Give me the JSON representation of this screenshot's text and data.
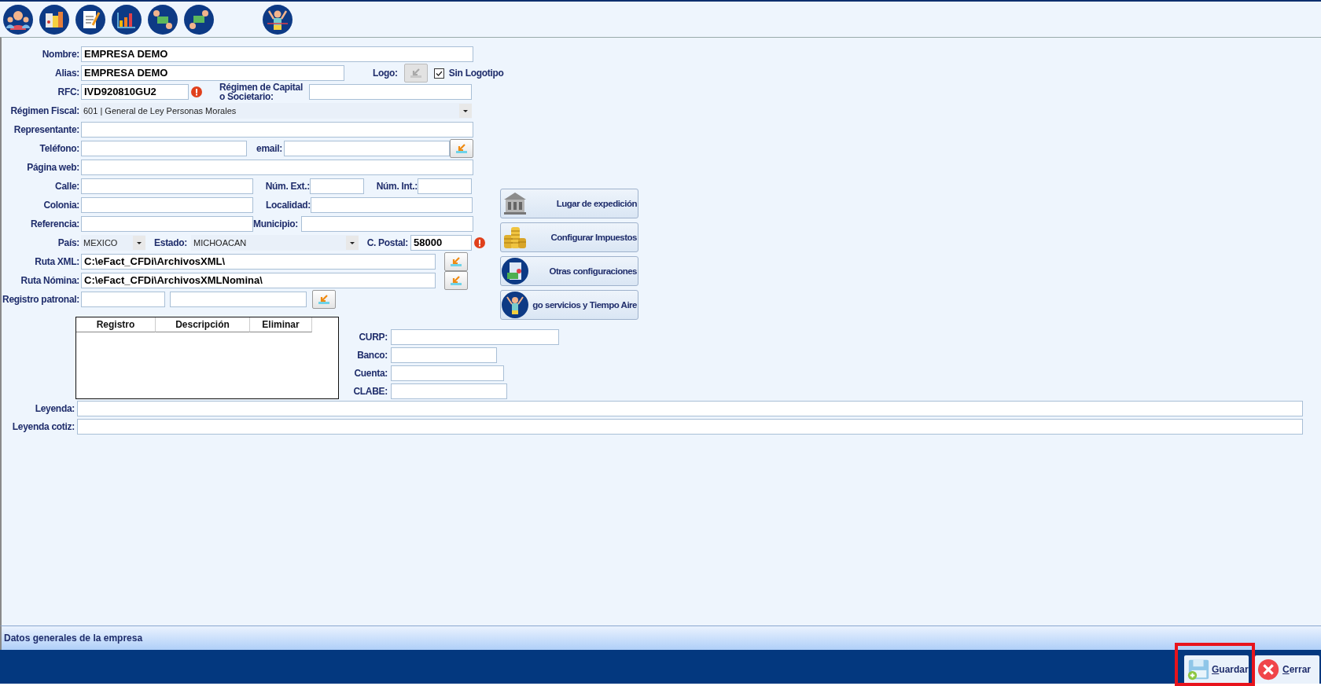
{
  "form": {
    "nombre": {
      "label": "Nombre:",
      "value": "EMPRESA DEMO"
    },
    "alias": {
      "label": "Alias:",
      "value": "EMPRESA DEMO"
    },
    "logo": {
      "label": "Logo:",
      "disabled": true
    },
    "sin_logotipo": {
      "label": "Sin Logotipo",
      "checked": true
    },
    "rfc": {
      "label": "RFC:",
      "value": "IVD920810GU2",
      "error": true
    },
    "regimen_capital": {
      "label": "Régimen de Capital o Societario:"
    },
    "regimen_fiscal": {
      "label": "Régimen Fiscal:",
      "value": "601 | General de Ley Personas Morales"
    },
    "representante": {
      "label": "Representante:"
    },
    "telefono": {
      "label": "Teléfono:"
    },
    "email": {
      "label": "email:"
    },
    "pagina_web": {
      "label": "Página web:"
    },
    "calle": {
      "label": "Calle:"
    },
    "num_ext": {
      "label": "Núm. Ext.:"
    },
    "num_int": {
      "label": "Núm. Int.:"
    },
    "colonia": {
      "label": "Colonia:"
    },
    "localidad": {
      "label": "Localidad:"
    },
    "referencia": {
      "label": "Referencia:"
    },
    "municipio": {
      "label": "Municipio:"
    },
    "pais": {
      "label": "País:",
      "value": "MEXICO"
    },
    "estado": {
      "label": "Estado:",
      "value": "MICHOACAN"
    },
    "c_postal": {
      "label": "C. Postal:",
      "value": "58000",
      "error": true
    },
    "ruta_xml": {
      "label": "Ruta XML:",
      "value": "C:\\eFact_CFDi\\ArchivosXML\\"
    },
    "ruta_nomina": {
      "label": "Ruta Nómina:",
      "value": "C:\\eFact_CFDi\\ArchivosXMLNomina\\"
    },
    "registro_patronal": {
      "label": "Registro patronal:"
    }
  },
  "side_buttons": [
    {
      "label": "Lugar de expedición"
    },
    {
      "label": "Configurar Impuestos"
    },
    {
      "label": "Otras configuraciones"
    },
    {
      "label": "go servicios y Tiempo Aire"
    }
  ],
  "registro_table": {
    "columns": [
      "Registro",
      "Descripción",
      "Eliminar"
    ]
  },
  "bank": {
    "curp": {
      "label": "CURP:"
    },
    "banco": {
      "label": "Banco:"
    },
    "cuenta": {
      "label": "Cuenta:"
    },
    "clabe": {
      "label": "CLABE:"
    }
  },
  "leyenda": {
    "label": "Leyenda:"
  },
  "leyenda_cotiz": {
    "label": "Leyenda cotiz:"
  },
  "status_bar": {
    "text": "Datos generales de la empresa"
  },
  "actions": [
    {
      "kind": "save",
      "label": "Guardar",
      "highlighted": true
    },
    {
      "kind": "close",
      "label": "Cerrar",
      "highlighted": false
    }
  ]
}
